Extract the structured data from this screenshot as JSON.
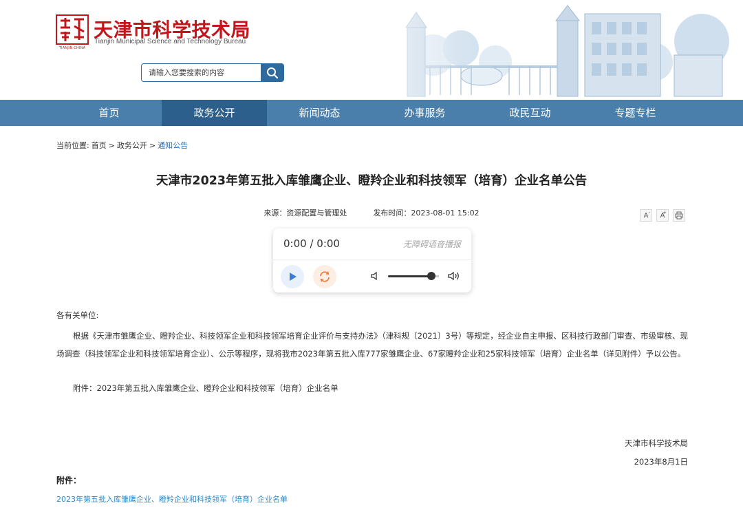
{
  "header": {
    "logo_emblem_text": "TIANJIN·CHINA",
    "site_title": "天津市科学技术局",
    "site_subtitle": "Tianjin Municipal Science and Technology Bureau",
    "search_placeholder": "请输入您要搜索的内容"
  },
  "nav": {
    "items": [
      {
        "label": "首页"
      },
      {
        "label": "政务公开"
      },
      {
        "label": "新闻动态"
      },
      {
        "label": "办事服务"
      },
      {
        "label": "政民互动"
      },
      {
        "label": "专题专栏"
      }
    ],
    "active_index": 1
  },
  "breadcrumb": {
    "prefix": "当前位置:",
    "items": [
      "首页",
      "政务公开",
      "通知公告"
    ],
    "separator": ">"
  },
  "article": {
    "title": "天津市2023年第五批入库雏鹰企业、瞪羚企业和科技领军（培育）企业名单公告",
    "source": "来源：资源配置与管理处",
    "publish_time": "发布时间：2023-08-01 15:02",
    "tools": {
      "font_decrease": "A",
      "font_increase": "A",
      "print_icon": "print-icon"
    },
    "salutation": "各有关单位:",
    "body": "根据《天津市雏鹰企业、瞪羚企业、科技领军企业和科技领军培育企业评价与支持办法》（津科规〔2021〕3号）等规定，经企业自主申报、区科技行政部门审查、市级审核、现场调查（科技领军企业和科技领军培育企业）、公示等程序，现将我市2023年第五批入库777家雏鹰企业、67家瞪羚企业和25家科技领军（培育）企业名单（详见附件）予以公告。",
    "attachment_line": "附件：2023年第五批入库雏鹰企业、瞪羚企业和科技领军（培育）企业名单",
    "signature_org": "天津市科学技术局",
    "signature_date": "2023年8月1日",
    "attachments_heading": "附件：",
    "attachment_link": "2023年第五批入库雏鹰企业、瞪羚企业和科技领军（培育）企业名单"
  },
  "player": {
    "time": "0:00 / 0:00",
    "label": "无障碍语音播报",
    "volume": 0.85,
    "accent_color": "#3a7bd5",
    "loop_color": "#f07b3f"
  },
  "colors": {
    "nav_bg": "#4a7fac",
    "nav_active": "#2c5f8c",
    "brand_red": "#c1161c",
    "link_blue": "#2a86c4"
  }
}
